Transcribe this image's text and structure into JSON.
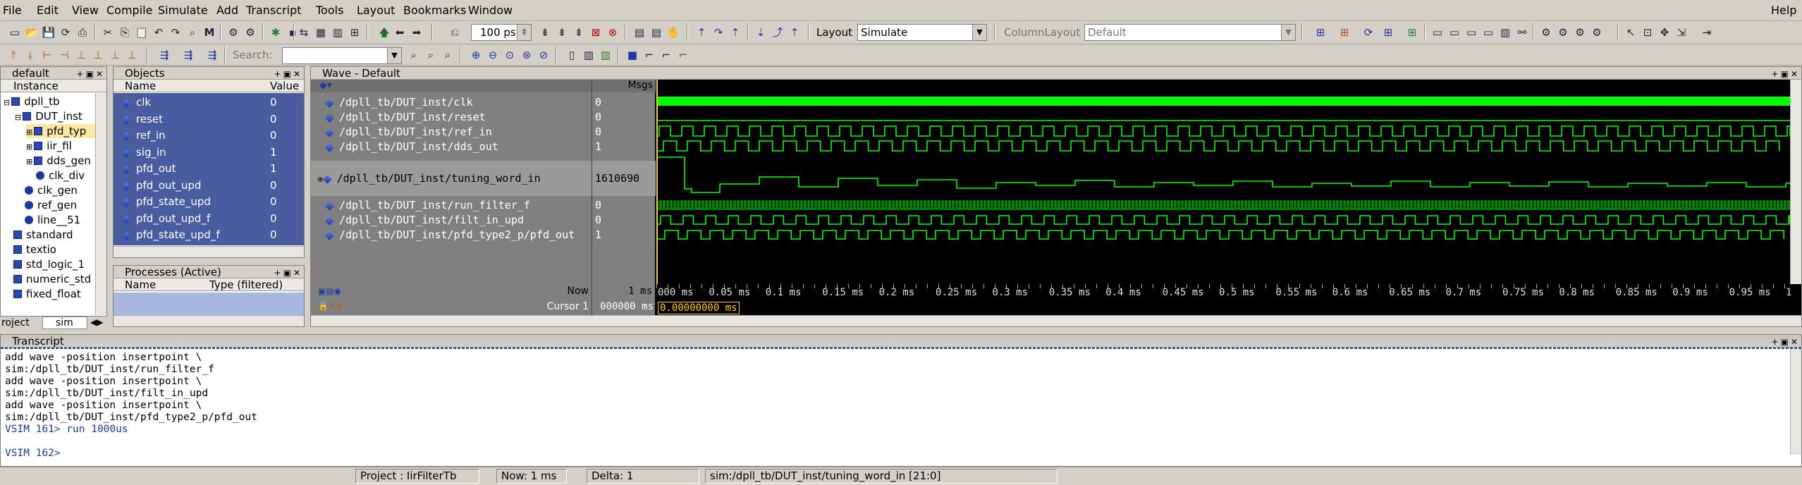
{
  "menu": [
    "File",
    "Edit",
    "View",
    "Compile",
    "Simulate",
    "Add",
    "Transcript",
    "Tools",
    "Layout",
    "Bookmarks",
    "Window"
  ],
  "help_label": "Help",
  "toolbar": {
    "run_length": "100 ps",
    "layout_label": "Layout",
    "layout_value": "Simulate",
    "column_layout_label": "ColumnLayout",
    "column_layout_value": "Default",
    "search_label": "Search:"
  },
  "instance_panel": {
    "title": "default",
    "column": "Instance",
    "items": [
      {
        "label": "dpll_tb",
        "level": 0,
        "expander": "-"
      },
      {
        "label": "DUT_inst",
        "level": 1,
        "expander": "-"
      },
      {
        "label": "pfd_typ",
        "level": 2,
        "expander": "+"
      },
      {
        "label": "iir_fil",
        "level": 2,
        "expander": "+"
      },
      {
        "label": "dds_gen",
        "level": 2,
        "expander": "+"
      },
      {
        "label": "clk_div",
        "level": 2,
        "expander": ""
      },
      {
        "label": "clk_gen",
        "level": 1,
        "expander": ""
      },
      {
        "label": "ref_gen",
        "level": 1,
        "expander": ""
      },
      {
        "label": "line__51",
        "level": 1,
        "expander": ""
      },
      {
        "label": "standard",
        "level": 0,
        "expander": ""
      },
      {
        "label": "textio",
        "level": 0,
        "expander": ""
      },
      {
        "label": "std_logic_1",
        "level": 0,
        "expander": ""
      },
      {
        "label": "numeric_std",
        "level": 0,
        "expander": ""
      },
      {
        "label": "fixed_float",
        "level": 0,
        "expander": ""
      }
    ],
    "tabs": [
      "roject",
      "sim"
    ]
  },
  "objects_panel": {
    "title": "Objects",
    "col_name": "Name",
    "col_value": "Value",
    "rows": [
      {
        "name": "clk",
        "value": "0"
      },
      {
        "name": "reset",
        "value": "0"
      },
      {
        "name": "ref_in",
        "value": "0"
      },
      {
        "name": "sig_in",
        "value": "1"
      },
      {
        "name": "pfd_out",
        "value": "1"
      },
      {
        "name": "pfd_out_upd",
        "value": "0"
      },
      {
        "name": "pfd_state_upd",
        "value": "0"
      },
      {
        "name": "pfd_out_upd_f",
        "value": "0"
      },
      {
        "name": "pfd_state_upd_f",
        "value": "0"
      }
    ]
  },
  "processes_panel": {
    "title": "Processes (Active)",
    "col_name": "Name",
    "col_type": "Type (filtered)"
  },
  "wave": {
    "title": "Wave - Default",
    "msgs_label": "Msgs",
    "signals": [
      {
        "name": "/dpll_tb/DUT_inst/clk",
        "value": "0"
      },
      {
        "name": "/dpll_tb/DUT_inst/reset",
        "value": "0"
      },
      {
        "name": "/dpll_tb/DUT_inst/ref_in",
        "value": "0"
      },
      {
        "name": "/dpll_tb/DUT_inst/dds_out",
        "value": "1"
      },
      {
        "name": "/dpll_tb/DUT_inst/tuning_word_in",
        "value": "1610690"
      },
      {
        "name": "/dpll_tb/DUT_inst/run_filter_f",
        "value": "0"
      },
      {
        "name": "/dpll_tb/DUT_inst/filt_in_upd",
        "value": "0"
      },
      {
        "name": "/dpll_tb/DUT_inst/pfd_type2_p/pfd_out",
        "value": "1"
      }
    ],
    "now_label": "Now",
    "now_value": "1 ms",
    "cursor_label": "Cursor 1",
    "cursor_value": "000000 ms",
    "cursor_time": "0.00000000 ms",
    "timeline": [
      "000 ms",
      "0.05 ms",
      "0.1 ms",
      "0.15 ms",
      "0.2 ms",
      "0.25 ms",
      "0.3 ms",
      "0.35 ms",
      "0.4 ms",
      "0.45 ms",
      "0.5 ms",
      "0.55 ms",
      "0.6 ms",
      "0.65 ms",
      "0.7 ms",
      "0.75 ms",
      "0.8 ms",
      "0.85 ms",
      "0.9 ms",
      "0.95 ms",
      "1"
    ]
  },
  "transcript": {
    "title": "Transcript",
    "lines": [
      "add wave -position insertpoint  \\",
      "sim:/dpll_tb/DUT_inst/run_filter_f",
      "add wave -position insertpoint  \\",
      "sim:/dpll_tb/DUT_inst/filt_in_upd",
      "add wave -position insertpoint  \\",
      "sim:/dpll_tb/DUT_inst/pfd_type2_p/pfd_out",
      "VSIM 161> run 1000us",
      "",
      "VSIM 162>"
    ]
  },
  "status": {
    "project": "Project : IirFilterTb",
    "now": "Now: 1 ms",
    "delta": "Delta: 1",
    "path": "sim:/dpll_tb/DUT_inst/tuning_word_in [21:0]"
  },
  "colors": {
    "wave_green": "#00ff00",
    "wave_bg": "#000000",
    "selection": "#1e3c8c",
    "cursor": "#ffd000"
  }
}
